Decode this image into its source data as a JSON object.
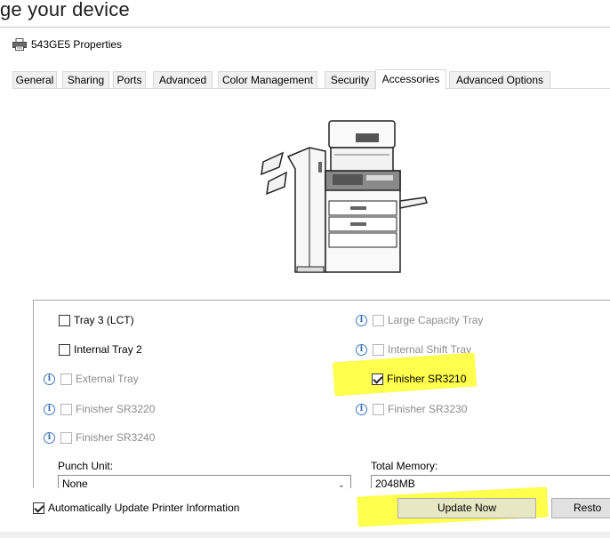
{
  "page": {
    "heading": "ge your device"
  },
  "window": {
    "title": "543GE5 Properties",
    "icon": "printer-icon"
  },
  "tabs": [
    {
      "label": "General",
      "active": false
    },
    {
      "label": "Sharing",
      "active": false
    },
    {
      "label": "Ports",
      "active": false
    },
    {
      "label": "Advanced",
      "active": false
    },
    {
      "label": "Color Management",
      "active": false
    },
    {
      "label": "Security",
      "active": false
    },
    {
      "label": "Accessories",
      "active": true
    },
    {
      "label": "Advanced Options",
      "active": false
    }
  ],
  "options": {
    "tray3": {
      "label": "Tray 3 (LCT)",
      "checked": false,
      "enabled": true
    },
    "internal_tray2": {
      "label": "Internal Tray 2",
      "checked": false,
      "enabled": true
    },
    "external_tray": {
      "label": "External Tray",
      "checked": false,
      "enabled": false,
      "info": true
    },
    "finisher_sr3220": {
      "label": "Finisher SR3220",
      "checked": false,
      "enabled": false,
      "info": true
    },
    "finisher_sr3240": {
      "label": "Finisher SR3240",
      "checked": false,
      "enabled": false,
      "info": true
    },
    "large_capacity_tray": {
      "label": "Large Capacity Tray",
      "checked": false,
      "enabled": false,
      "info": true
    },
    "internal_shift_tray": {
      "label": "Internal Shift Tray",
      "checked": false,
      "enabled": false,
      "info": true
    },
    "finisher_sr3210": {
      "label": "Finisher SR3210",
      "checked": true,
      "enabled": true
    },
    "finisher_sr3230": {
      "label": "Finisher SR3230",
      "checked": false,
      "enabled": false,
      "info": true
    }
  },
  "punch_unit": {
    "label": "Punch Unit:",
    "value": "None"
  },
  "total_memory": {
    "label": "Total Memory:",
    "value": "2048MB"
  },
  "auto_update": {
    "label": "Automatically Update Printer Information",
    "checked": true
  },
  "buttons": {
    "update_now": "Update Now",
    "restore": "Resto"
  },
  "colors": {
    "highlight": "#ffff2e",
    "info_blue": "#3a78c9",
    "tab_bg": "#f0f0f0"
  }
}
